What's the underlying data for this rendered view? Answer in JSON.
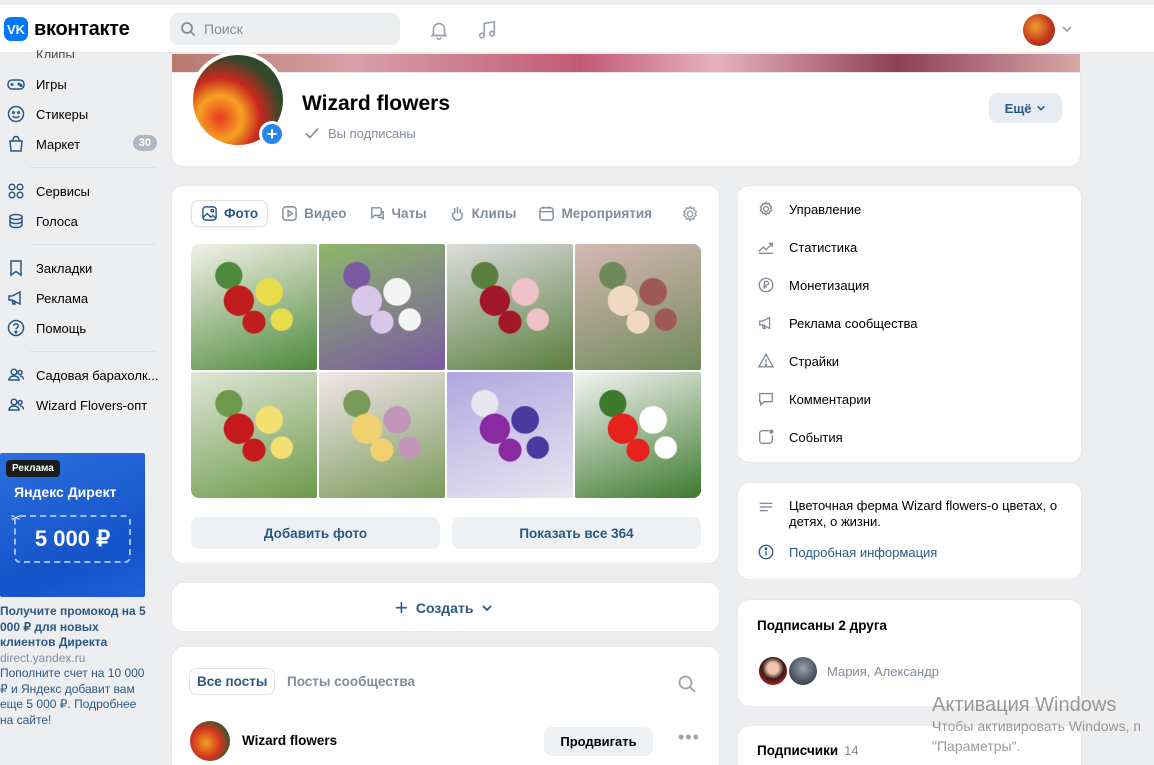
{
  "header": {
    "logo_mark": "VK",
    "logo_text": "вконтакте",
    "search_placeholder": "Поиск"
  },
  "sidebar": {
    "top_partial": "Клипы",
    "items": [
      {
        "label": "Игры",
        "icon": "gamepad-icon"
      },
      {
        "label": "Стикеры",
        "icon": "smile-icon"
      },
      {
        "label": "Маркет",
        "icon": "bag-icon",
        "badge": "30"
      },
      {
        "label": "Сервисы",
        "icon": "grid-icon"
      },
      {
        "label": "Голоса",
        "icon": "coins-icon"
      },
      {
        "label": "Закладки",
        "icon": "bookmark-icon"
      },
      {
        "label": "Реклама",
        "icon": "megaphone-icon"
      },
      {
        "label": "Помощь",
        "icon": "help-icon"
      },
      {
        "label": "Садовая барахолк...",
        "icon": "users-icon"
      },
      {
        "label": "Wizard Flovers-опт",
        "icon": "users-icon"
      }
    ]
  },
  "ad": {
    "tag": "Реклама",
    "brand": "Яндекс Директ",
    "amount": "5 000 ₽",
    "title": "Получите промокод на 5 000 ₽ для новых клиентов Директа",
    "domain": "direct.yandex.ru",
    "description": "Пополните счет на 10 000 ₽ и Яндекс добавит вам еще 5 000 ₽. Подробнее на сайте!"
  },
  "group": {
    "name": "Wizard flowers",
    "status": "Вы подписаны",
    "more_label": "Ещё"
  },
  "media": {
    "tabs": [
      {
        "label": "Фото",
        "icon": "photo-icon",
        "active": true
      },
      {
        "label": "Видео",
        "icon": "video-icon"
      },
      {
        "label": "Чаты",
        "icon": "chat-icon"
      },
      {
        "label": "Клипы",
        "icon": "clips-icon"
      },
      {
        "label": "Мероприятия",
        "icon": "calendar-icon"
      }
    ],
    "add_photo": "Добавить фото",
    "show_all": "Показать все 364",
    "photo_colors": [
      [
        "#f4f1e8",
        "#c01d1f",
        "#e8dc4a",
        "#4d8a3b"
      ],
      [
        "#8cb86a",
        "#d9c6ea",
        "#f5f5f5",
        "#7a5aa0"
      ],
      [
        "#dcdcdc",
        "#a31829",
        "#f0c0c8",
        "#5a7f3f"
      ],
      [
        "#d6b8b4",
        "#f0d8c0",
        "#a05a55",
        "#6f8a5a"
      ],
      [
        "#e0e6d8",
        "#c41a1e",
        "#f4e070",
        "#6c9a4a"
      ],
      [
        "#f2e6ea",
        "#f1d070",
        "#c095b8",
        "#7a9a5a"
      ],
      [
        "#b0a6e0",
        "#8a2aa0",
        "#4a3aa0",
        "#e9e6f0"
      ],
      [
        "#f4f4f4",
        "#e6221c",
        "#ffffff",
        "#3e7a2e"
      ]
    ]
  },
  "create": {
    "label": "Создать"
  },
  "posts": {
    "tab_all": "Все посты",
    "tab_community": "Посты сообщества",
    "author": "Wizard flowers",
    "promote": "Продвигать"
  },
  "manage": {
    "items": [
      {
        "label": "Управление",
        "icon": "gear-icon"
      },
      {
        "label": "Статистика",
        "icon": "stats-icon"
      },
      {
        "label": "Монетизация",
        "icon": "ruble-icon"
      },
      {
        "label": "Реклама сообщества",
        "icon": "megaphone-icon"
      },
      {
        "label": "Страйки",
        "icon": "warning-icon"
      },
      {
        "label": "Комментарии",
        "icon": "comment-icon"
      },
      {
        "label": "События",
        "icon": "events-icon"
      }
    ]
  },
  "info": {
    "description": "Цветочная ферма Wizard flowers-о цветах, о детях, о жизни.",
    "details_link": "Подробная информация"
  },
  "friends": {
    "title": "Подписаны 2 друга",
    "names": "Мария, Александр"
  },
  "subscribers": {
    "title": "Подписчики",
    "count": "14"
  },
  "watermark": {
    "title": "Активация Windows",
    "line1": "Чтобы активировать Windows, п",
    "line2": "\"Параметры\"."
  }
}
